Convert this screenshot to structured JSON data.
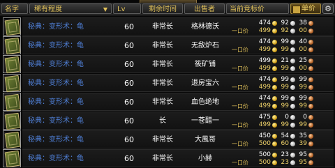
{
  "window": {
    "title": ""
  },
  "header": {
    "name": "名字",
    "rarity": "稀有程度",
    "rarity_sort_icon": "sort-down-triangle",
    "level": "Lv",
    "time_left": "剩余时间",
    "seller": "出售者",
    "current_bid": "当前竞标价",
    "unit_price": "单价",
    "unit_price_checked": true,
    "settings_icon": "gear-icon"
  },
  "buyout_label": "一口价",
  "colors": {
    "item_name": "#4f7fd6",
    "header_text": "#e2c25a",
    "buyout_text": "#f0d36a"
  },
  "items": [
    {
      "name": "秘典：变形术：龟",
      "level": "60",
      "time": "非常长",
      "seller": "格林德沃",
      "bid": [
        "474",
        "92",
        "38"
      ],
      "buyout": [
        "499",
        "92",
        "00"
      ]
    },
    {
      "name": "秘典：变形术：龟",
      "level": "60",
      "time": "非常长",
      "seller": "无敌炉石",
      "bid": [
        "474",
        "99",
        "40"
      ],
      "buyout": [
        "499",
        "99",
        "00"
      ]
    },
    {
      "name": "秘典：变形术：龟",
      "level": "60",
      "time": "非常长",
      "seller": "筱矿铺",
      "bid": [
        "499",
        "21",
        "25"
      ],
      "buyout": [
        "499",
        "99",
        "00"
      ]
    },
    {
      "name": "秘典：变形术：龟",
      "level": "60",
      "time": "非常长",
      "seller": "退房宝六",
      "bid": [
        "474",
        "99",
        "99"
      ],
      "buyout": [
        "499",
        "99",
        "99"
      ]
    },
    {
      "name": "秘典：变形术：龟",
      "level": "60",
      "time": "非常长",
      "seller": "血色绝地",
      "bid": [
        "474",
        "99",
        "99"
      ],
      "buyout": [
        "499",
        "99",
        "99"
      ]
    },
    {
      "name": "秘典：变形术：龟",
      "level": "60",
      "time": "长",
      "seller": "一苍醋一",
      "bid": [
        "475",
        "0",
        "0"
      ],
      "buyout": [
        "499",
        "99",
        "99"
      ]
    },
    {
      "name": "秘典：变形术：龟",
      "level": "60",
      "time": "非常长",
      "seller": "大風哥",
      "bid": [
        "450",
        "54",
        "35"
      ],
      "buyout": [
        "500",
        "60",
        "39"
      ]
    },
    {
      "name": "秘典：变形术：龟",
      "level": "60",
      "time": "非常长",
      "seller": "小赫",
      "bid": [
        "500",
        "23",
        "95"
      ],
      "buyout": [
        "500",
        "23",
        "95"
      ]
    }
  ]
}
